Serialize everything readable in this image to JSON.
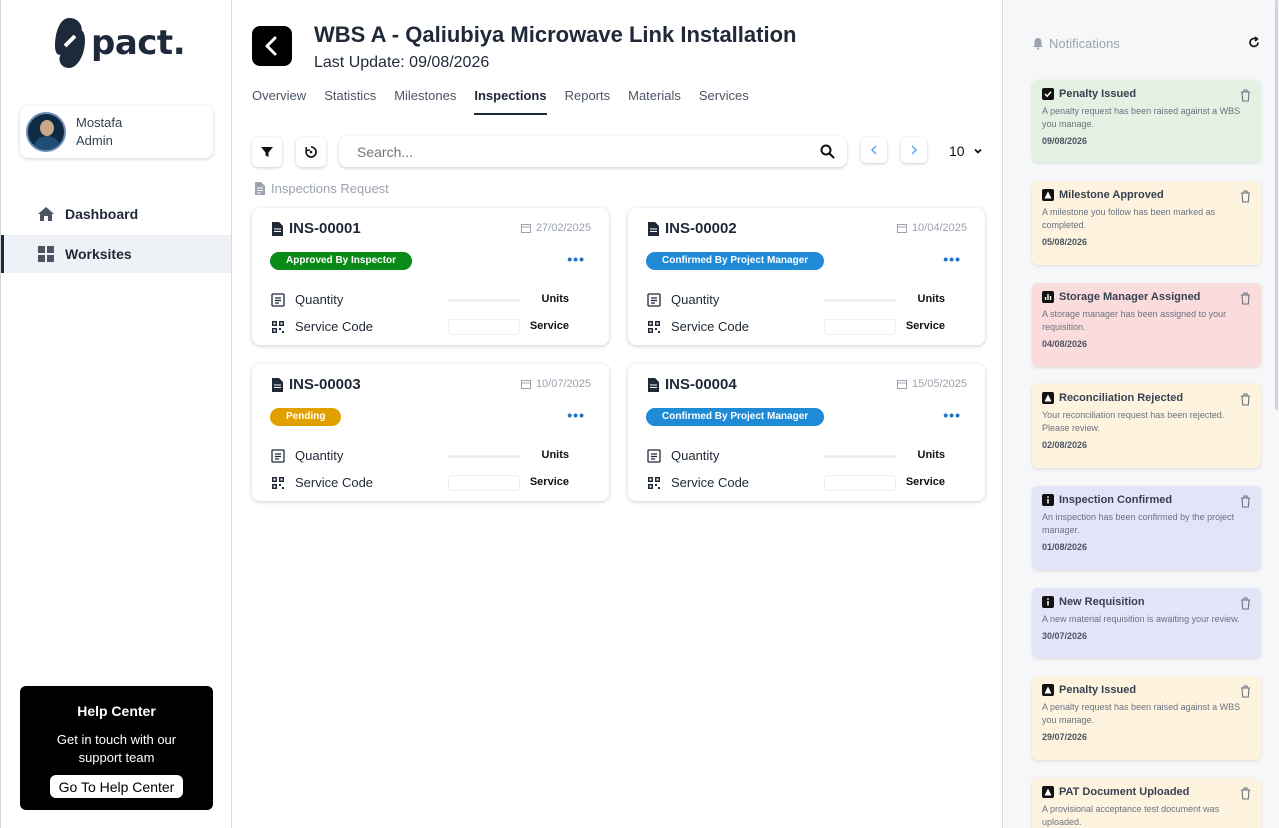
{
  "brand": {
    "name": "pact."
  },
  "user": {
    "name": "Mostafa",
    "role": "Admin"
  },
  "nav": [
    {
      "label": "Dashboard",
      "icon": "home-icon",
      "active": false
    },
    {
      "label": "Worksites",
      "icon": "grid-icon",
      "active": true
    }
  ],
  "help": {
    "title": "Help Center",
    "text": "Get in touch with our support team",
    "button": "Go To Help Center"
  },
  "header": {
    "title": "WBS A - Qaliubiya Microwave Link Installation",
    "subtitle": "Last Update: 09/08/2026"
  },
  "tabs": [
    "Overview",
    "Statistics",
    "Milestones",
    "Inspections",
    "Reports",
    "Materials",
    "Services"
  ],
  "active_tab": "Inspections",
  "search": {
    "placeholder": "Search...",
    "value": ""
  },
  "per_page": "10",
  "section_label": "Inspections Request",
  "row_labels": {
    "quantity": "Quantity",
    "service_code": "Service Code",
    "units": "Units",
    "service": "Service"
  },
  "inspections": [
    {
      "id": "INS-00001",
      "date": "27/02/2025",
      "status": "Approved By Inspector",
      "status_color": "#0a8a16"
    },
    {
      "id": "INS-00002",
      "date": "10/04/2025",
      "status": "Confirmed By Project Manager",
      "status_color": "#1f8bd6"
    },
    {
      "id": "INS-00003",
      "date": "10/07/2025",
      "status": "Pending",
      "status_color": "#e0a100"
    },
    {
      "id": "INS-00004",
      "date": "15/05/2025",
      "status": "Confirmed By Project Manager",
      "status_color": "#1f8bd6"
    }
  ],
  "notifications_title": "Notifications",
  "notifications": [
    {
      "title": "Penalty Issued",
      "message": "A penalty request has been raised against a WBS you manage.",
      "date": "09/08/2026",
      "bg": "#e3f1e3"
    },
    {
      "title": "Milestone Approved",
      "message": "A milestone you follow has been marked as completed.",
      "date": "05/08/2026",
      "bg": "#fdf3df"
    },
    {
      "title": "Storage Manager Assigned",
      "message": "A storage manager has been assigned to your requisition.",
      "date": "04/08/2026",
      "bg": "#fbdcdc"
    },
    {
      "title": "Reconciliation Rejected",
      "message": "Your reconciliation request has been rejected. Please review.",
      "date": "02/08/2026",
      "bg": "#fdf3df"
    },
    {
      "title": "Inspection Confirmed",
      "message": "An inspection has been confirmed by the project manager.",
      "date": "01/08/2026",
      "bg": "#e3e4f8"
    },
    {
      "title": "New Requisition",
      "message": "A new material requisition is awaiting your review.",
      "date": "30/07/2026",
      "bg": "#e3e4f8"
    },
    {
      "title": "Penalty Issued",
      "message": "A penalty request has been raised against a WBS you manage.",
      "date": "29/07/2026",
      "bg": "#fdf3df"
    },
    {
      "title": "PAT Document Uploaded",
      "message": "A provisional acceptance test document was uploaded.",
      "date": "",
      "bg": "#fdf3df"
    }
  ]
}
